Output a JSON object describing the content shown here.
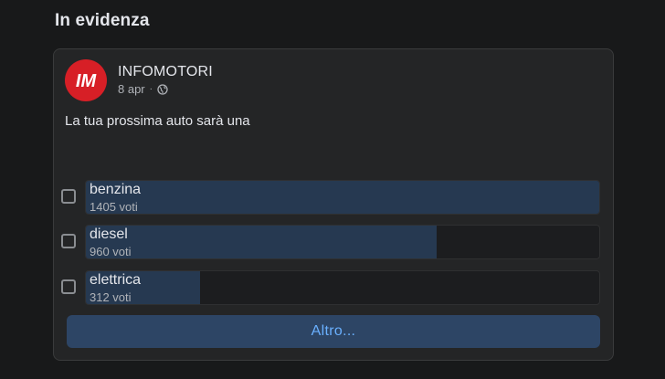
{
  "section": {
    "title": "In evidenza"
  },
  "post": {
    "page_name": "INFOMOTORI",
    "date": "8 apr",
    "separator": "·",
    "logo_text": "IM",
    "audience_icon": "globe-icon",
    "text": "La tua prossima auto sarà una"
  },
  "poll": {
    "options": [
      {
        "label": "benzina",
        "votes": "1405 voti",
        "vote_count": 1405
      },
      {
        "label": "diesel",
        "votes": "960 voti",
        "vote_count": 960
      },
      {
        "label": "elettrica",
        "votes": "312 voti",
        "vote_count": 312
      }
    ],
    "more_label": "Altro..."
  },
  "colors": {
    "background": "#18191a",
    "card": "#242526",
    "bar_fill": "#263951",
    "button": "#2d4565",
    "button_text": "#6ab0ff",
    "logo_red": "#d71f26"
  }
}
